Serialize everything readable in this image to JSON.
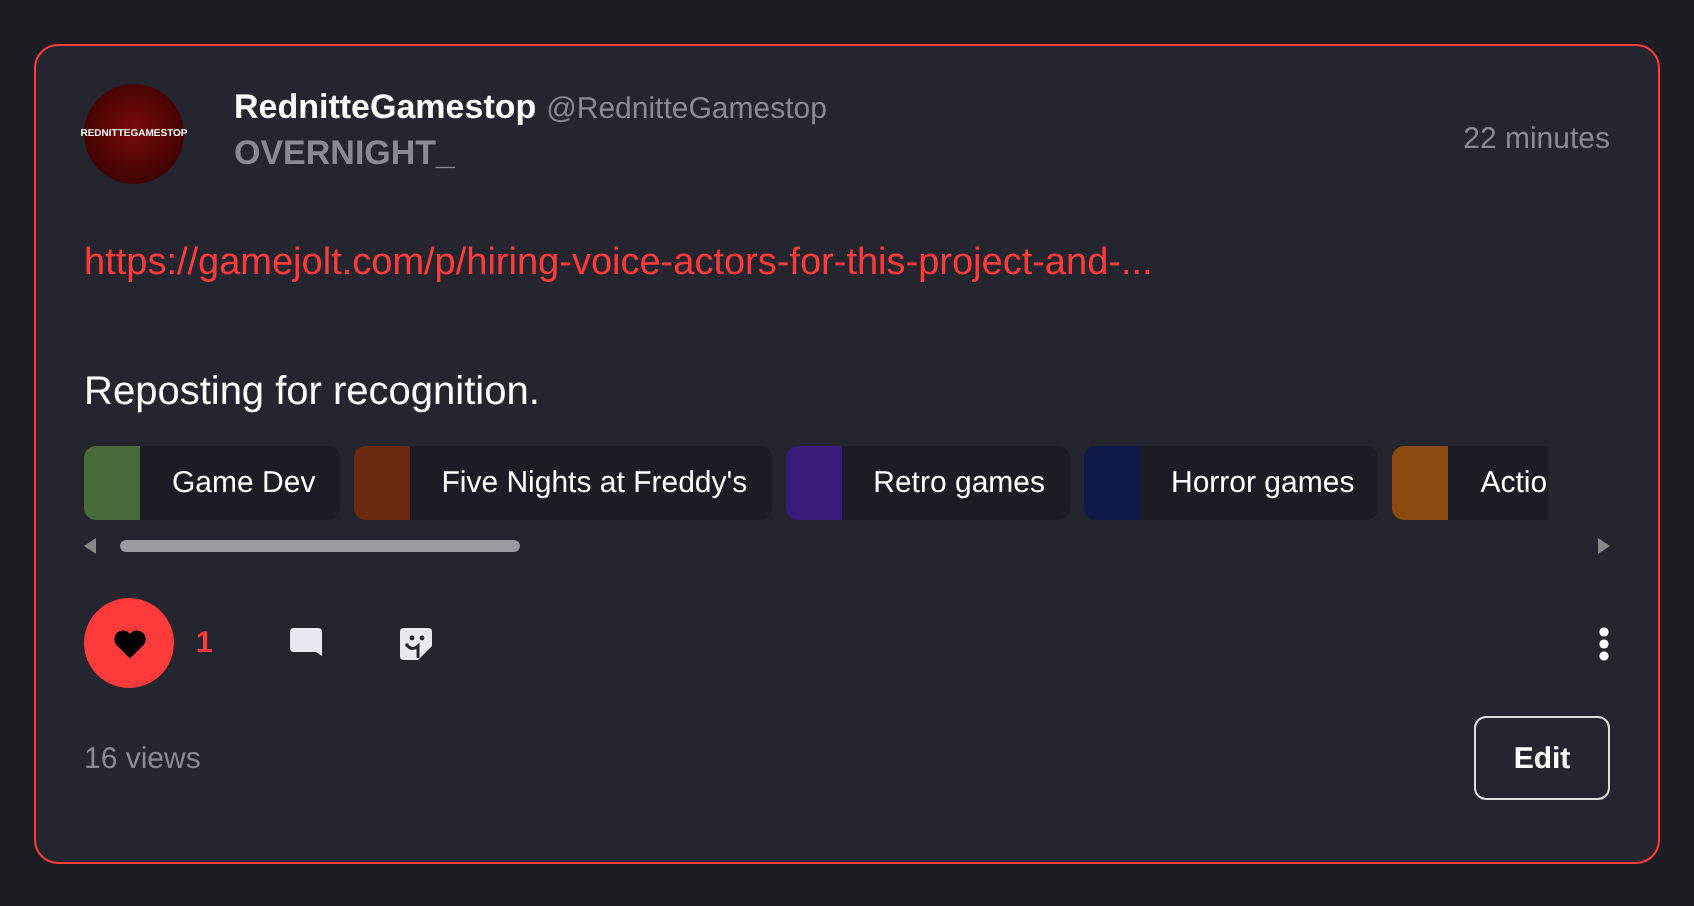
{
  "post": {
    "author": {
      "name": "RednitteGamestop",
      "handle": "@RednitteGamestop",
      "avatar_text": "REDNITTEGAMESTOP"
    },
    "community": "OVERNIGHT_",
    "time": "22 minutes",
    "link": "https://gamejolt.com/p/hiring-voice-actors-for-this-project-and-...",
    "body": "Reposting for recognition.",
    "tags": [
      {
        "label": "Game Dev"
      },
      {
        "label": "Five Nights at Freddy's"
      },
      {
        "label": "Retro games"
      },
      {
        "label": "Horror games"
      },
      {
        "label": "Actio"
      }
    ],
    "like": {
      "liked": true,
      "count": "1"
    },
    "views": "16 views",
    "edit_button": "Edit"
  }
}
